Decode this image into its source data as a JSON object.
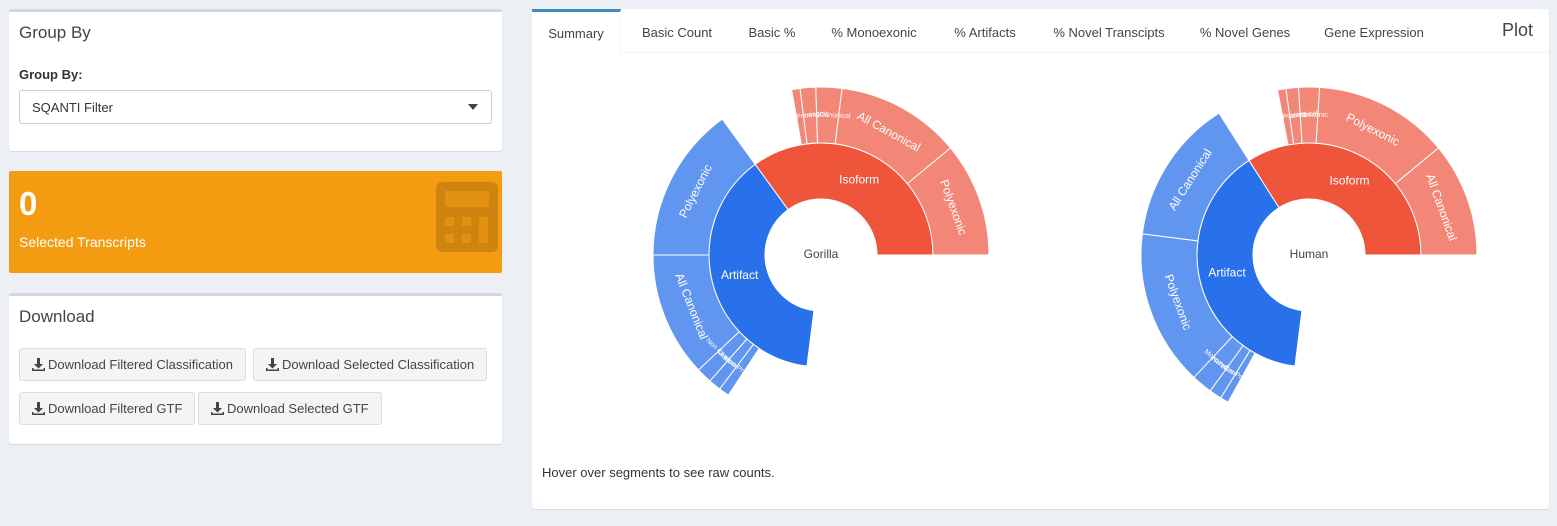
{
  "groupby": {
    "title": "Group By",
    "label": "Group By:",
    "selected": "SQANTI Filter"
  },
  "valuebox": {
    "value": "0",
    "subtitle": "Selected Transcripts",
    "icon": "calculator-icon",
    "color": "#f39c12"
  },
  "download": {
    "title": "Download",
    "buttons": [
      "Download Filtered Classification",
      "Download Selected Classification",
      "Download Filtered GTF",
      "Download Selected GTF"
    ]
  },
  "tabs": [
    "Summary",
    "Basic Count",
    "Basic %",
    "% Monoexonic",
    "% Artifacts",
    "% Novel Transcipts",
    "% Novel Genes",
    "Gene Expression"
  ],
  "active_tab": "Summary",
  "plot_title": "Plot",
  "hover_note": "Hover over segments to see raw counts.",
  "colors": {
    "isoform": "#ef553b",
    "isoform_light": "#f28777",
    "artifact": "#2971eb",
    "artifact_light": "#6096ef"
  },
  "chart_data": [
    {
      "type": "sunburst",
      "root": "Gorilla",
      "children": [
        {
          "name": "Isoform",
          "share": 0.35,
          "children": [
            {
              "name": "Polyexonic",
              "share": 0.11
            },
            {
              "name": "All Canonical",
              "share": 0.12
            },
            {
              "name": "Non Canonical",
              "share": 0.025
            },
            {
              "name": "Monoexonic",
              "share": 0.015
            },
            {
              "name": "Intra-Priming",
              "share": 0.008
            }
          ]
        },
        {
          "name": "Artifact",
          "share": 0.38,
          "children": [
            {
              "name": "Polyexonic",
              "share": 0.15
            },
            {
              "name": "All Canonical",
              "share": 0.12
            },
            {
              "name": "Non Canonical",
              "share": 0.015
            },
            {
              "name": "Monoexonic",
              "share": 0.012
            },
            {
              "name": "Intra-Priming",
              "share": 0.01
            }
          ]
        }
      ]
    },
    {
      "type": "sunburst",
      "root": "Human",
      "children": [
        {
          "name": "Isoform",
          "share": 0.34,
          "children": [
            {
              "name": "All Canonical",
              "share": 0.11
            },
            {
              "name": "Polyexonic",
              "share": 0.13
            },
            {
              "name": "Monoexonic",
              "share": 0.02
            },
            {
              "name": "Non Canonical",
              "share": 0.012
            },
            {
              "name": "Intra-Priming",
              "share": 0.008
            }
          ]
        },
        {
          "name": "Artifact",
          "share": 0.39,
          "children": [
            {
              "name": "All Canonical",
              "share": 0.14
            },
            {
              "name": "Polyexonic",
              "share": 0.15
            },
            {
              "name": "Monoexonic",
              "share": 0.02
            },
            {
              "name": "Non Canonical",
              "share": 0.012
            },
            {
              "name": "Intra-Priming",
              "share": 0.008
            }
          ]
        }
      ]
    }
  ]
}
